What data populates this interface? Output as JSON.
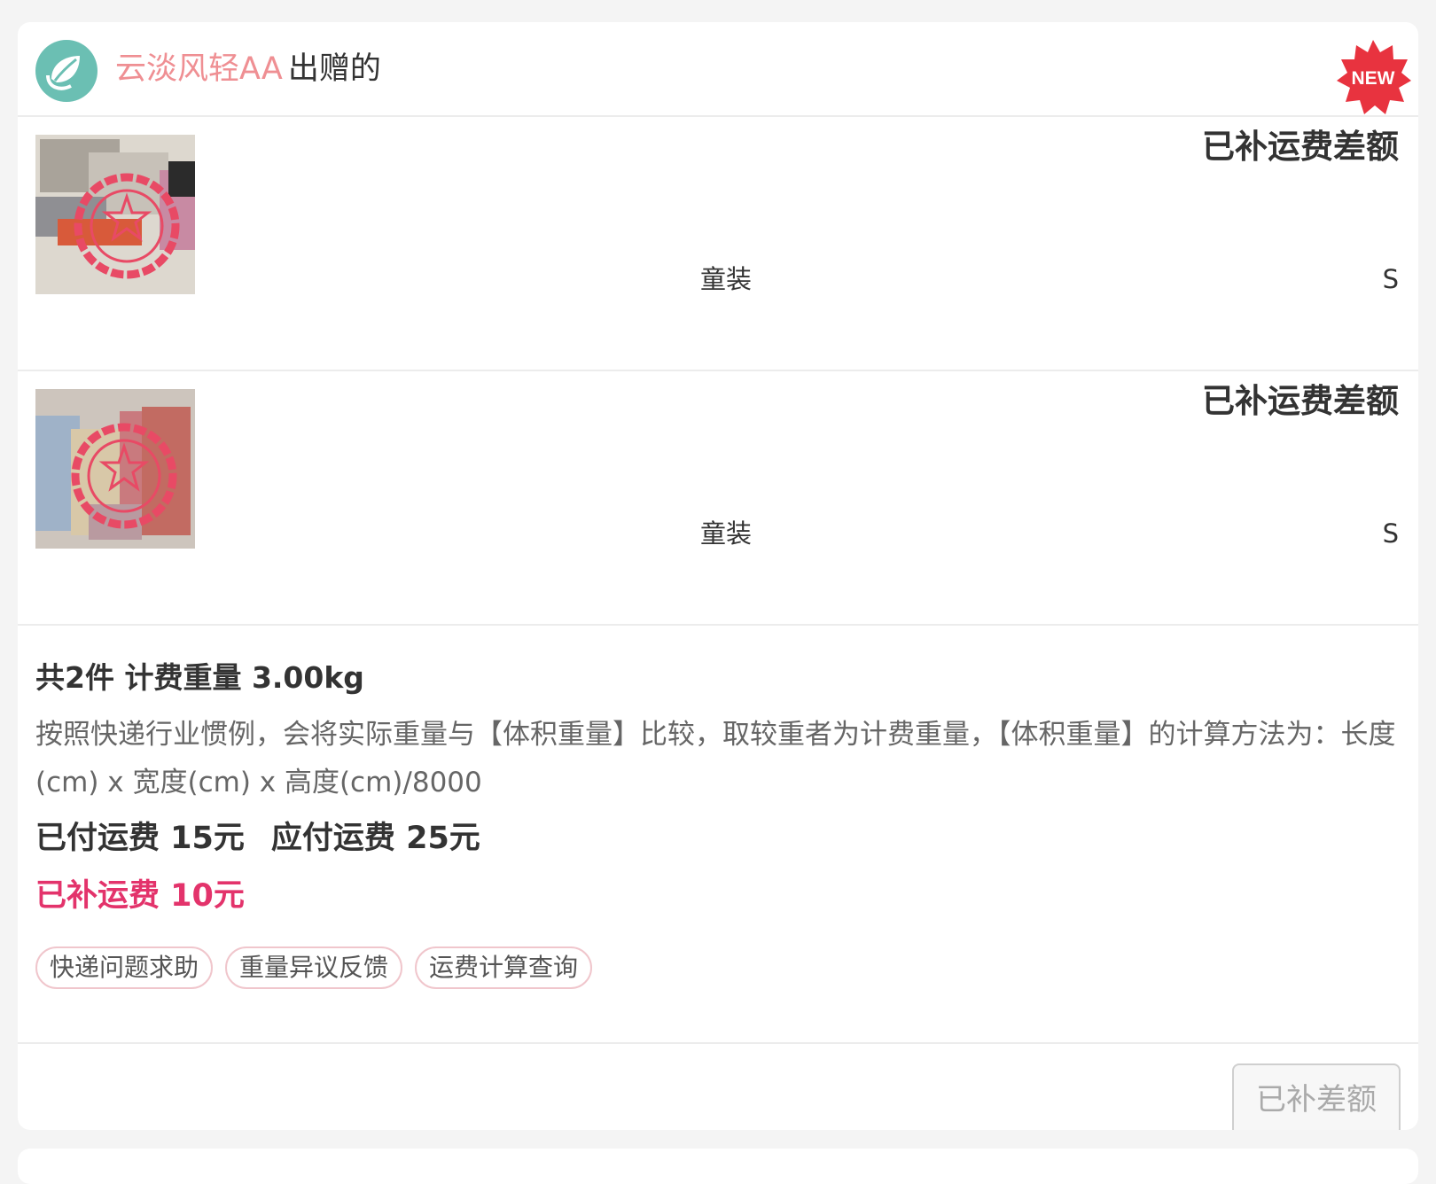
{
  "donor": {
    "name": "云淡风轻AA",
    "suffix": "出赠的"
  },
  "badge": {
    "text": "NEW",
    "color": "#e8333f"
  },
  "items": [
    {
      "status": "已补运费差额",
      "category": "童装",
      "size": "S",
      "thumb_icon": "clothes-photo-stamped"
    },
    {
      "status": "已补运费差额",
      "category": "童装",
      "size": "S",
      "thumb_icon": "clothes-photo-stamped"
    }
  ],
  "summary": {
    "title": "共2件 计费重量 3.00kg",
    "note": "按照快递行业惯例，会将实际重量与【体积重量】比较，取较重者为计费重量，【体积重量】的计算方法为：长度(cm) x 宽度(cm) x 高度(cm)/8000",
    "paid": "已付运费 15元",
    "due": "应付运费 25元",
    "extra": "已补运费 10元",
    "tags": [
      "快递问题求助",
      "重量异议反馈",
      "运费计算查询"
    ]
  },
  "footer": {
    "button": "已补差额"
  },
  "colors": {
    "accent": "#e3336b",
    "donor_name": "#ef8f93",
    "avatar": "#6bbfb3"
  }
}
